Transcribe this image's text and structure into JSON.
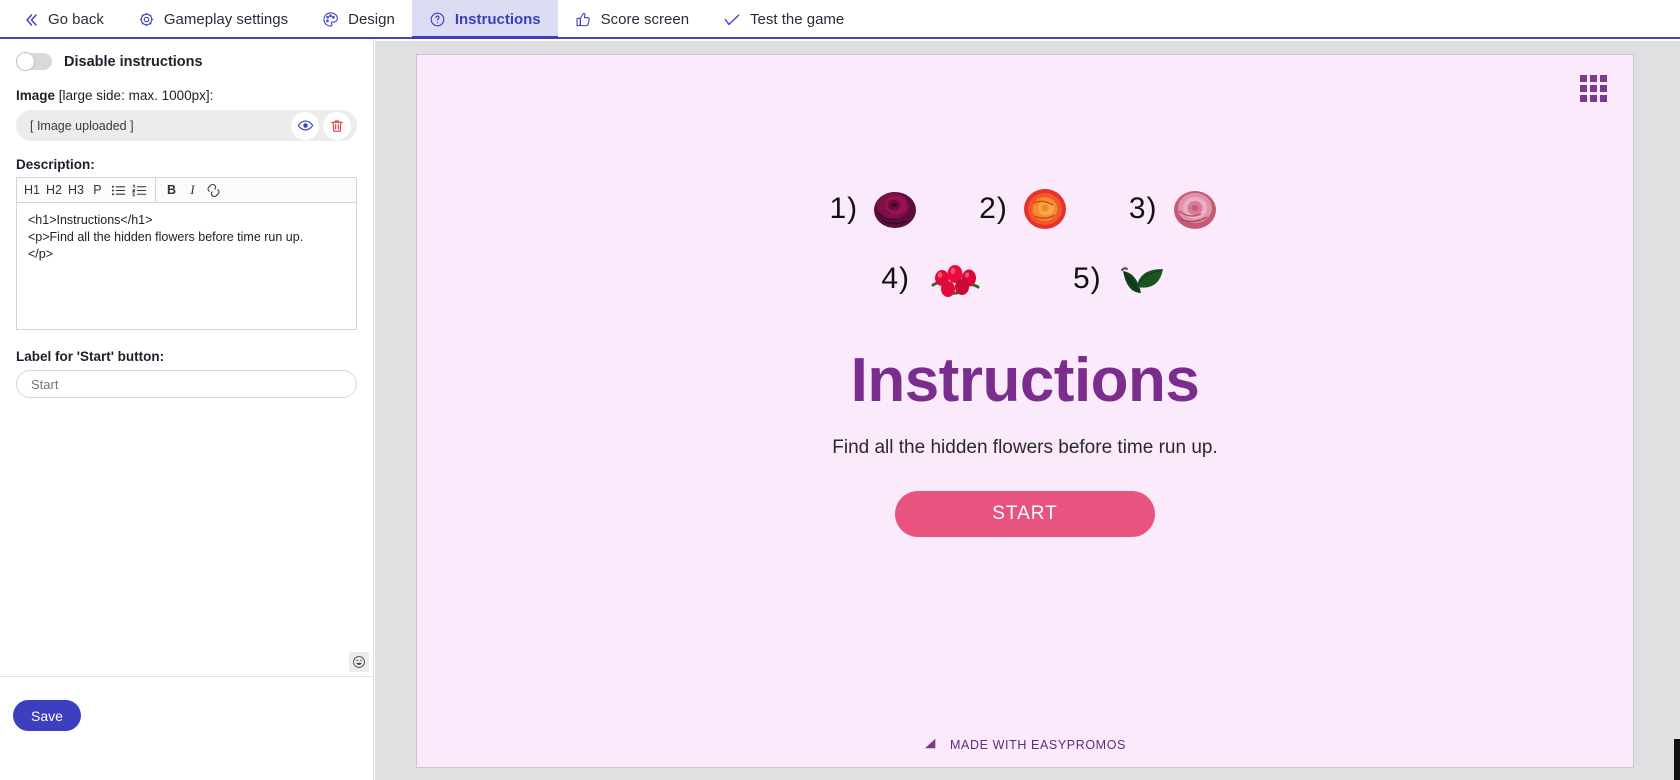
{
  "topnav": {
    "items": [
      {
        "label": "Go back",
        "icon": "chevrons-left-icon",
        "active": false
      },
      {
        "label": "Gameplay settings",
        "icon": "gear-icon",
        "active": false
      },
      {
        "label": "Design",
        "icon": "palette-icon",
        "active": false
      },
      {
        "label": "Instructions",
        "icon": "question-circle-icon",
        "active": true
      },
      {
        "label": "Score screen",
        "icon": "thumbs-up-icon",
        "active": false
      },
      {
        "label": "Test the game",
        "icon": "check-icon",
        "active": false
      }
    ]
  },
  "sidebar": {
    "disable_instructions_label": "Disable instructions",
    "image_label_bold": "Image",
    "image_label_light": " [large side: max. 1000px]:",
    "image_value": "[ Image uploaded ]",
    "preview_icon": "eye-icon",
    "delete_icon": "trash-icon",
    "description_label": "Description:",
    "toolbar": {
      "h1": "H1",
      "h2": "H2",
      "h3": "H3",
      "p": "P",
      "ul": "bullet-list-icon",
      "ol": "numbered-list-icon",
      "bold": "B",
      "italic": "I",
      "link": "link-icon"
    },
    "description_value": "<h1>Instructions</h1>\n<p>Find all the hidden flowers before time run up.\n</p>",
    "emoji_icon": "emoji-icon",
    "start_label_title": "Label for 'Start' button:",
    "start_input_placeholder": "Start",
    "start_input_value": "",
    "save_label": "Save"
  },
  "preview": {
    "grid_icon": "grid-menu-icon",
    "flowers": [
      {
        "num": "1)",
        "name": "dark-purple-rose"
      },
      {
        "num": "2)",
        "name": "orange-rose"
      },
      {
        "num": "3)",
        "name": "pink-rose"
      },
      {
        "num": "4)",
        "name": "red-rose-hips"
      },
      {
        "num": "5)",
        "name": "green-leaves"
      }
    ],
    "title": "Instructions",
    "subtitle": "Find all the hidden flowers before time run up.",
    "start_button": "START",
    "footer": "MADE WITH EASYPROMOS",
    "footer_icon": "easypromos-logo-icon"
  },
  "colors": {
    "accent_blue": "#3b3fc0",
    "nav_active_bg": "#dcdcf5",
    "preview_bg": "#fbeafb",
    "title_purple": "#7b2d8e",
    "start_pink": "#e8537f",
    "footer_purple": "#5c2f73"
  }
}
